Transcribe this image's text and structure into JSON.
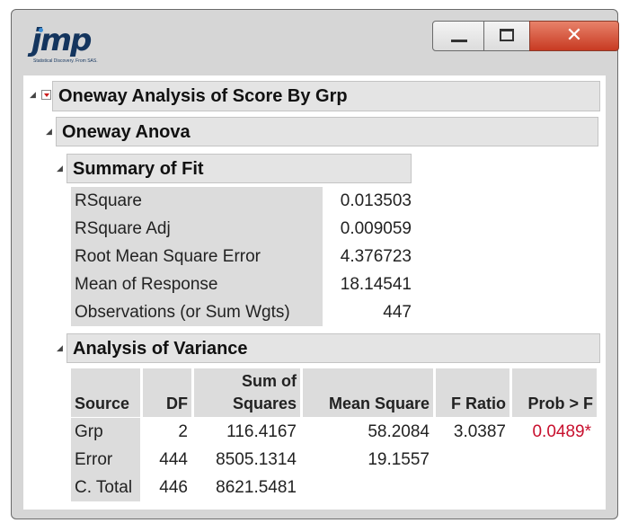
{
  "app": {
    "logo_text": "jmp",
    "logo_tagline": "Statistical Discovery. From SAS."
  },
  "window_controls": {
    "minimize": "minimize-icon",
    "maximize": "maximize-icon",
    "close": "close-icon"
  },
  "report": {
    "title": "Oneway Analysis of Score By Grp",
    "anova_title": "Oneway Anova",
    "summary_title": "Summary of Fit",
    "summary": [
      {
        "label": "RSquare",
        "value": "0.013503"
      },
      {
        "label": "RSquare Adj",
        "value": "0.009059"
      },
      {
        "label": "Root Mean Square Error",
        "value": "4.376723"
      },
      {
        "label": "Mean of Response",
        "value": "18.14541"
      },
      {
        "label": "Observations (or Sum Wgts)",
        "value": "447"
      }
    ],
    "variance_title": "Analysis of Variance",
    "variance_headers": {
      "source": "Source",
      "df": "DF",
      "ss_line1": "Sum of",
      "ss_line2": "Squares",
      "ms": "Mean Square",
      "f": "F Ratio",
      "p": "Prob > F"
    },
    "variance_rows": [
      {
        "source": "Grp",
        "df": "2",
        "ss": "116.4167",
        "ms": "58.2084",
        "f": "3.0387",
        "p": "0.0489*"
      },
      {
        "source": "Error",
        "df": "444",
        "ss": "8505.1314",
        "ms": "19.1557",
        "f": "",
        "p": ""
      },
      {
        "source": "C. Total",
        "df": "446",
        "ss": "8621.5481",
        "ms": "",
        "f": "",
        "p": ""
      }
    ]
  },
  "colors": {
    "significant": "#c8102e",
    "header_bg": "#e4e4e4",
    "label_bg": "#dcdcdc",
    "close_button": "#d04a30"
  }
}
